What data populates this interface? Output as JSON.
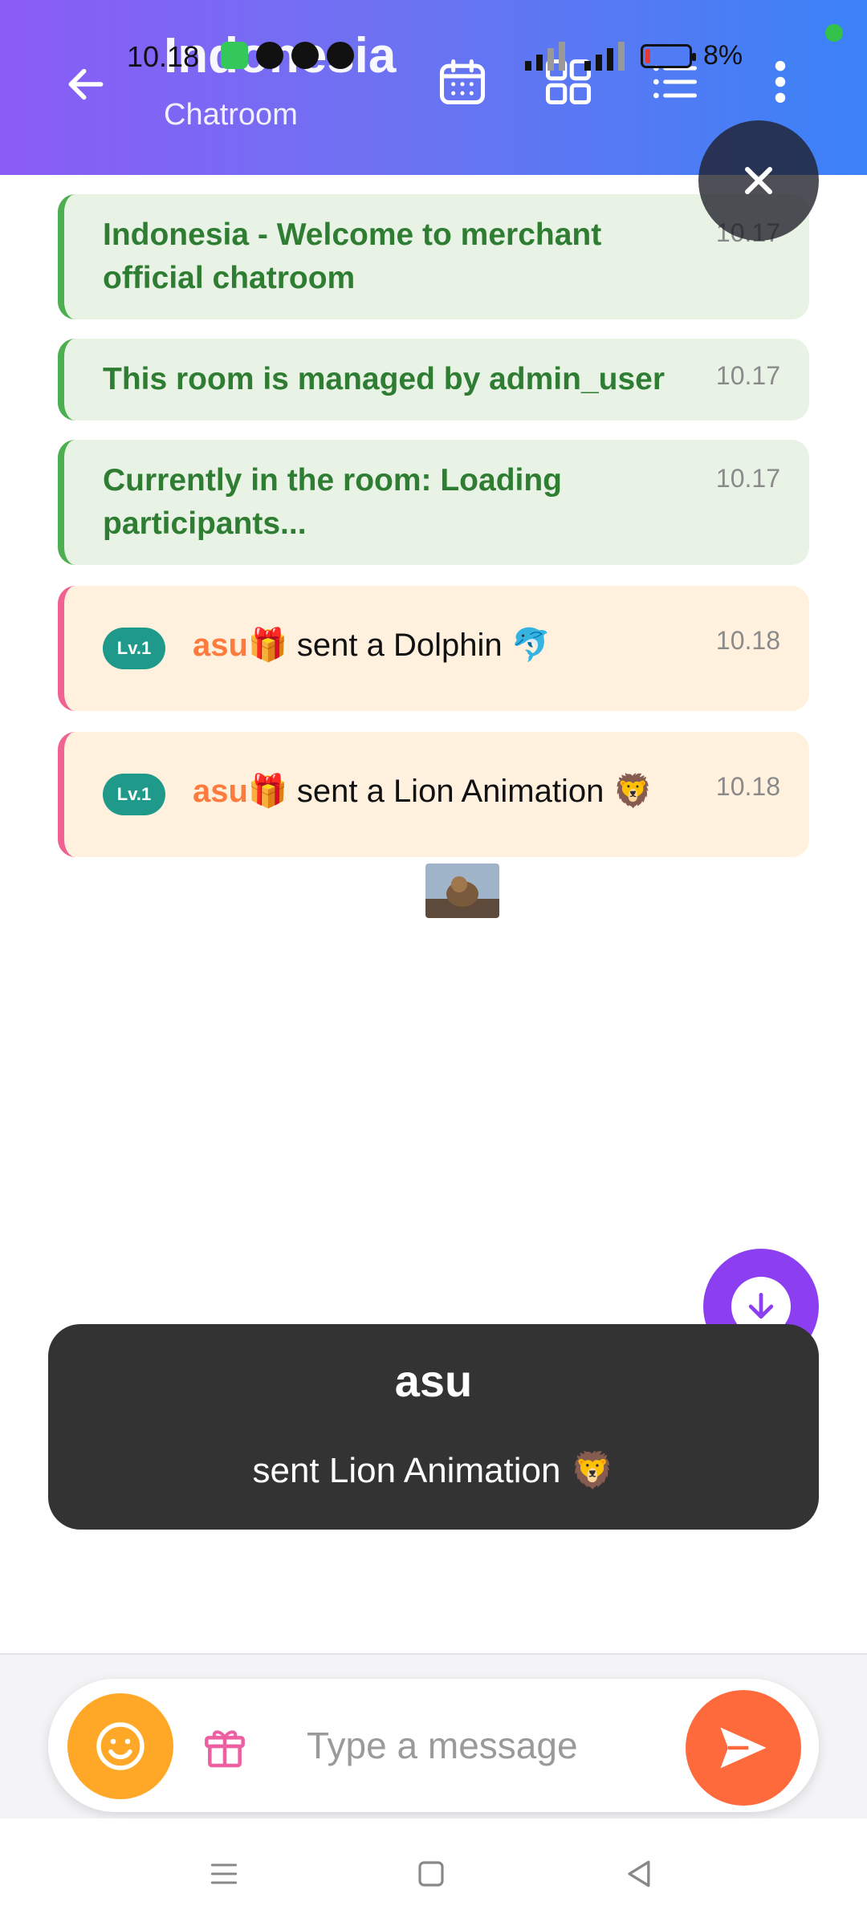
{
  "status_bar": {
    "time": "10.18",
    "battery": "8%"
  },
  "header": {
    "title": "Indonesia",
    "subtitle": "Chatroom",
    "icons": [
      "back-arrow-icon",
      "calendar-icon",
      "grid-icon",
      "list-icon",
      "more-vertical-icon"
    ]
  },
  "messages": [
    {
      "type": "system",
      "text": "Indonesia - Welcome to merchant official chatroom",
      "time": "10.17"
    },
    {
      "type": "system",
      "text": "This room is managed by admin_user",
      "time": "10.17"
    },
    {
      "type": "system",
      "text": "Currently in the room: Loading participants...",
      "time": "10.17"
    },
    {
      "type": "gift",
      "level": "Lv.1",
      "user": "asu🎁",
      "action": "sent a Dolphin 🐬",
      "time": "10.18"
    },
    {
      "type": "gift",
      "level": "Lv.1",
      "user": "asu🎁",
      "action": "sent a Lion Animation 🦁",
      "time": "10.18"
    }
  ],
  "toast": {
    "user": "asu",
    "message": "sent Lion Animation 🦁"
  },
  "composer": {
    "placeholder": "Type a message",
    "value": ""
  },
  "colors": {
    "header_start": "#8b5cf6",
    "header_end": "#3b82f6",
    "system_bg": "#e8f3e6",
    "system_text": "#2e7d32",
    "gift_bg": "#fff1dd",
    "gift_border": "#f06292",
    "username": "#ff7a3d",
    "level_badge": "#1f9a8a",
    "send_button": "#ff6a3d",
    "emoji_button": "#ffa726",
    "scroll_fab": "#8b3ff0",
    "toast_bg": "#333333"
  }
}
